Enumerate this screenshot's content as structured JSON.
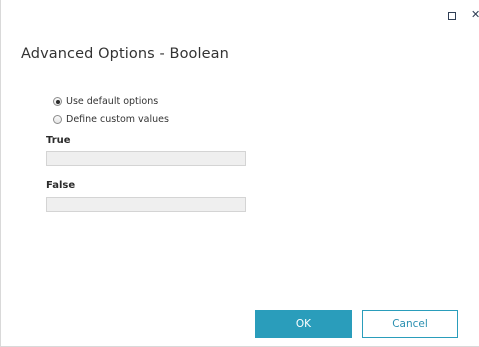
{
  "window": {
    "maximize_icon": "maximize-icon",
    "close_icon": "close-icon",
    "close_glyph": "✕"
  },
  "dialog": {
    "title": "Advanced Options - Boolean"
  },
  "options": {
    "use_default": {
      "label": "Use default options",
      "checked": true
    },
    "define_custom": {
      "label": "Define custom values",
      "checked": false
    }
  },
  "fields": {
    "true_label": "True",
    "true_value": "",
    "false_label": "False",
    "false_value": ""
  },
  "buttons": {
    "ok": "OK",
    "cancel": "Cancel"
  },
  "colors": {
    "accent": "#2a9dbb",
    "field_bg": "#efefef"
  }
}
